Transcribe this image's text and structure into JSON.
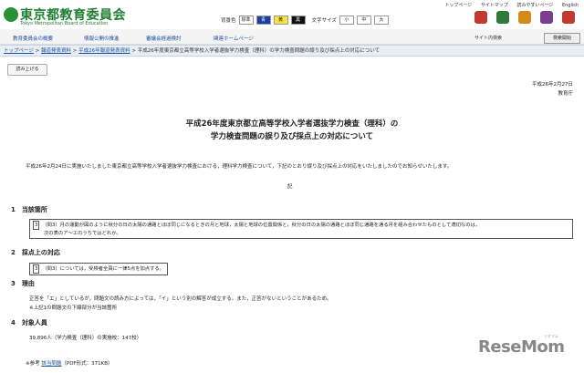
{
  "header": {
    "logo_jp": "東京都教育委員会",
    "logo_en": "Tokyo Metropolitan Board of Education",
    "top_links": [
      "トップページ",
      "サイトマップ",
      "読みやすいページ",
      "English"
    ],
    "bgcolor_label": "背景色",
    "bg_options": [
      "標準",
      "青",
      "黄",
      "黒"
    ],
    "fontsize_label": "文字サイズ",
    "fontsize_options": [
      "小",
      "中",
      "大"
    ],
    "icon_colors": [
      "#c23a2f",
      "#2f7a3a",
      "#d68a19",
      "#7a3d8f",
      "#c23a2f"
    ]
  },
  "nav": {
    "items": [
      "教育委員会の概要",
      "情報公開の推進",
      "審議会経過検討",
      "関連ホームページ"
    ],
    "search_label": "サイト内検索",
    "search_button": "検索開始"
  },
  "breadcrumb": {
    "items": [
      "トップページ",
      "報道発表資料",
      "平成26年報道発表資料"
    ],
    "current": "平成26年度東京都立高等学校入学者選抜学力検査（理科）の学力検査問題の誤り及び採点上の対応について"
  },
  "read_button": "読み上げる",
  "date": "平成26年2月27日",
  "issuer": "教育庁",
  "title_line1": "平成26年度東京都立高等学校入学者選抜学力検査（理科）の",
  "title_line2": "学力検査問題の誤り及び採点上の対応について",
  "intro": "平成26年2月24日に実施いたしました東京都立高等学校入学者選抜学力検査における，理科学力検査について，下記のとおり誤り及び採点上の対応をいたしましたのでお知らせいたします。",
  "ki": "記",
  "s1": {
    "heading": "1　当該箇所",
    "box_tag": "3",
    "line1": "〔問3〕月の運動が図のように秋分の日の太陽の通路とほぼ同じになるときの月と地球，太陽と地球の位置関係と，秋分の日の太陽の通路とほぼ同じ通路を通る月を組み合わせたものとして適切なのは，",
    "line2": "次の表のア～エのうちではどれか。"
  },
  "s2": {
    "heading": "2　採点上の対応",
    "box_tag": "3",
    "text": "〔問3〕については，受検者全員に一律5点を加点する。"
  },
  "s3": {
    "heading": "3　理由",
    "line1": "正答を「エ」としているが，問題文の読み方によっては，「イ」という別の解答が成立する。また，正答がないということがあるため。",
    "line2": "※上記1の問題文の下線部分が当該箇所"
  },
  "s4": {
    "heading": "4　対象人員",
    "text": "39,896人（学力検査（理科）の実施校：147校）"
  },
  "ref": {
    "prefix": "※参考",
    "link": "該当問題",
    "suffix": "（PDF形式：371KB）"
  },
  "watermark": {
    "main": "ReseMom",
    "small": "リセマム"
  }
}
